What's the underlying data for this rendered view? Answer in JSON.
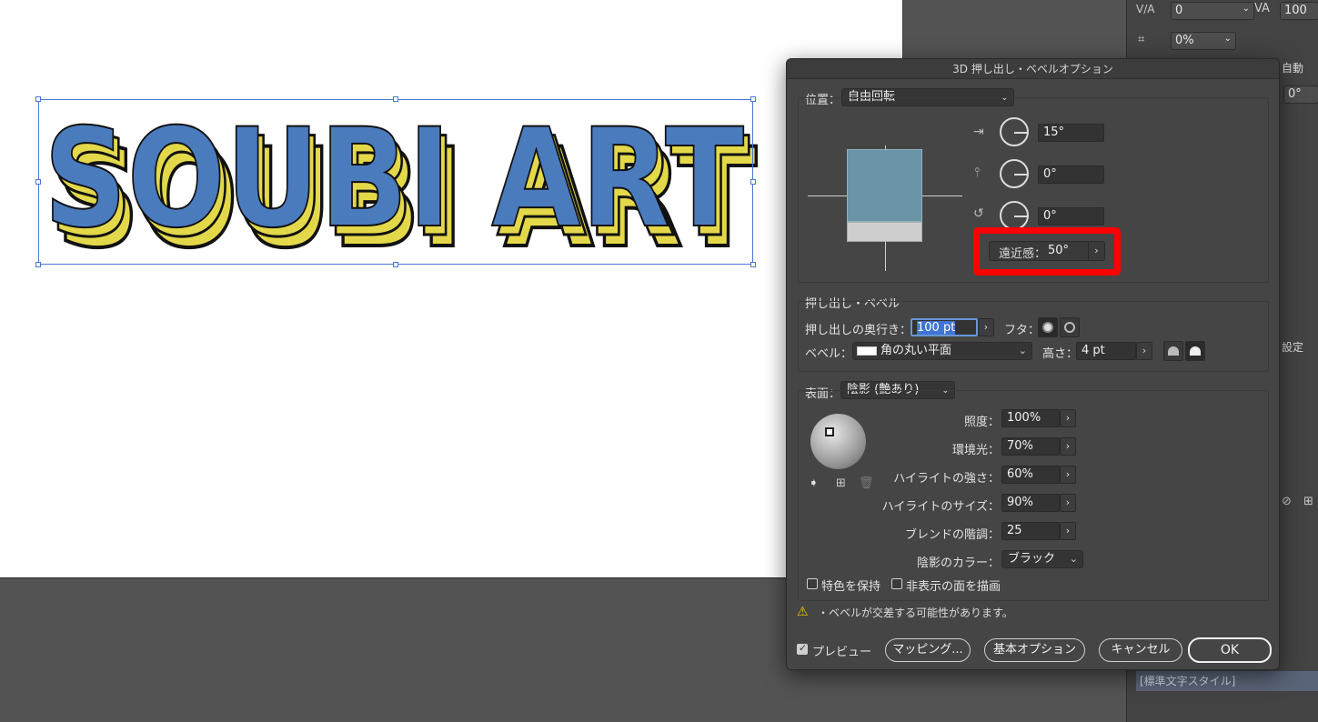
{
  "artwork": {
    "text": "SOUBI ART"
  },
  "side_panel": {
    "tracking_value": "0",
    "tracking_right_value": "100",
    "tsume_value": "0%",
    "auto_label": "自動",
    "angle_value": "0°",
    "setting_label": "設定",
    "char_style": "[標準文字スタイル]"
  },
  "dialog": {
    "title": "3D 押し出し・ベベルオプション",
    "position": {
      "label": "位置：",
      "value": "自由回転",
      "rot_x": "15°",
      "rot_y": "0°",
      "rot_z": "0°",
      "perspective_label": "遠近感：",
      "perspective_value": "50°"
    },
    "extrude": {
      "section": "押し出し・ベベル",
      "depth_label": "押し出しの奥行き：",
      "depth_value": "100 pt",
      "cap_label": "フタ：",
      "bevel_label": "ベベル：",
      "bevel_value": "角の丸い平面",
      "height_label": "高さ：",
      "height_value": "4 pt"
    },
    "surface": {
      "label": "表面：",
      "value": "陰影 (艶あり)",
      "light_intensity_label": "照度：",
      "light_intensity": "100%",
      "ambient_label": "環境光：",
      "ambient": "70%",
      "highlight_intensity_label": "ハイライトの強さ：",
      "highlight_intensity": "60%",
      "highlight_size_label": "ハイライトのサイズ：",
      "highlight_size": "90%",
      "blend_steps_label": "ブレンドの階調：",
      "blend_steps": "25",
      "shading_color_label": "陰影のカラー：",
      "shading_color": "ブラック"
    },
    "options": {
      "preserve_spot": "特色を保持",
      "draw_hidden": "非表示の面を描画"
    },
    "warning": "・ベベルが交差する可能性があります。",
    "footer": {
      "preview": "プレビュー",
      "mapping": "マッピング...",
      "basic_options": "基本オプション",
      "cancel": "キャンセル",
      "ok": "OK"
    }
  },
  "colors": {
    "highlight_box": "#ff0000",
    "text_fill": "#4a7bbd",
    "text_extrude": "#e3d84a"
  }
}
